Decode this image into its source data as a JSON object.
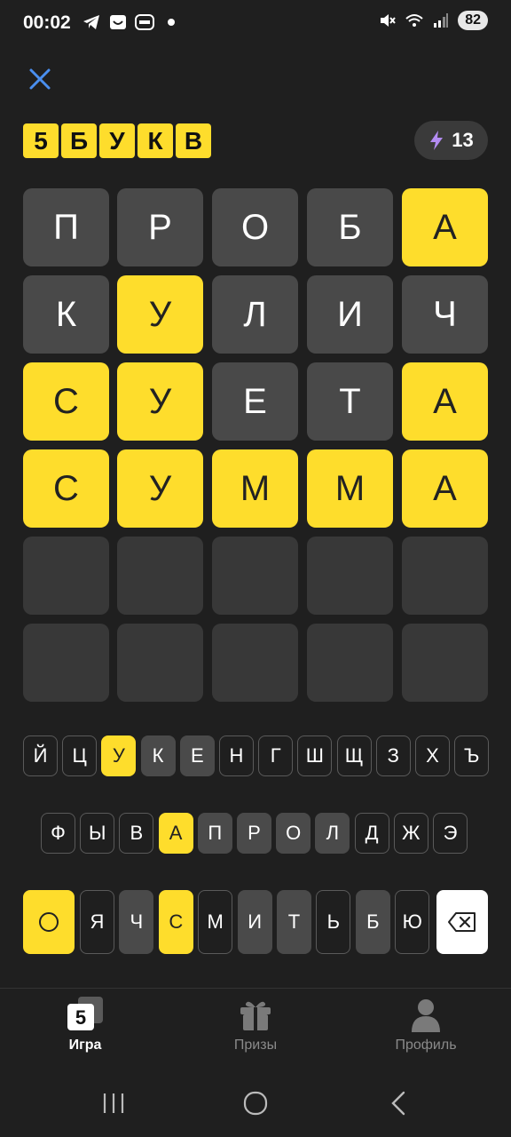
{
  "status": {
    "time": "00:02",
    "battery": "82",
    "icons": [
      "telegram-icon",
      "smile-app-icon",
      "burger-king-icon",
      "dot-icon",
      "mute-icon",
      "wifi-icon",
      "signal-icon"
    ]
  },
  "header": {
    "close_icon": "close-icon",
    "logo_letters": [
      "5",
      "Б",
      "У",
      "К",
      "В"
    ],
    "energy_icon": "lightning-icon",
    "energy_count": "13"
  },
  "board": {
    "rows": [
      [
        {
          "l": "П",
          "s": "gray"
        },
        {
          "l": "Р",
          "s": "gray"
        },
        {
          "l": "О",
          "s": "gray"
        },
        {
          "l": "Б",
          "s": "gray"
        },
        {
          "l": "А",
          "s": "yellow"
        }
      ],
      [
        {
          "l": "К",
          "s": "gray"
        },
        {
          "l": "У",
          "s": "yellow"
        },
        {
          "l": "Л",
          "s": "gray"
        },
        {
          "l": "И",
          "s": "gray"
        },
        {
          "l": "Ч",
          "s": "gray"
        }
      ],
      [
        {
          "l": "С",
          "s": "yellow"
        },
        {
          "l": "У",
          "s": "yellow"
        },
        {
          "l": "Е",
          "s": "gray"
        },
        {
          "l": "Т",
          "s": "gray"
        },
        {
          "l": "А",
          "s": "yellow"
        }
      ],
      [
        {
          "l": "С",
          "s": "yellow"
        },
        {
          "l": "У",
          "s": "yellow"
        },
        {
          "l": "М",
          "s": "yellow"
        },
        {
          "l": "М",
          "s": "yellow"
        },
        {
          "l": "А",
          "s": "yellow"
        }
      ],
      [
        {
          "l": "",
          "s": "empty"
        },
        {
          "l": "",
          "s": "empty"
        },
        {
          "l": "",
          "s": "empty"
        },
        {
          "l": "",
          "s": "empty"
        },
        {
          "l": "",
          "s": "empty"
        }
      ],
      [
        {
          "l": "",
          "s": "empty"
        },
        {
          "l": "",
          "s": "empty"
        },
        {
          "l": "",
          "s": "empty"
        },
        {
          "l": "",
          "s": "empty"
        },
        {
          "l": "",
          "s": "empty"
        }
      ]
    ]
  },
  "keyboard": {
    "row1": [
      {
        "k": "Й",
        "s": "default"
      },
      {
        "k": "Ц",
        "s": "default"
      },
      {
        "k": "У",
        "s": "yellow"
      },
      {
        "k": "К",
        "s": "gray"
      },
      {
        "k": "Е",
        "s": "gray"
      },
      {
        "k": "Н",
        "s": "default"
      },
      {
        "k": "Г",
        "s": "default"
      },
      {
        "k": "Ш",
        "s": "default"
      },
      {
        "k": "Щ",
        "s": "default"
      },
      {
        "k": "З",
        "s": "default"
      },
      {
        "k": "Х",
        "s": "default"
      },
      {
        "k": "Ъ",
        "s": "default"
      }
    ],
    "row2": [
      {
        "k": "Ф",
        "s": "default"
      },
      {
        "k": "Ы",
        "s": "default"
      },
      {
        "k": "В",
        "s": "default"
      },
      {
        "k": "А",
        "s": "yellow"
      },
      {
        "k": "П",
        "s": "gray"
      },
      {
        "k": "Р",
        "s": "gray"
      },
      {
        "k": "О",
        "s": "gray"
      },
      {
        "k": "Л",
        "s": "gray"
      },
      {
        "k": "Д",
        "s": "default"
      },
      {
        "k": "Ж",
        "s": "default"
      },
      {
        "k": "Э",
        "s": "default"
      }
    ],
    "row3": [
      {
        "k": "Я",
        "s": "default"
      },
      {
        "k": "Ч",
        "s": "gray"
      },
      {
        "k": "С",
        "s": "yellow"
      },
      {
        "k": "М",
        "s": "default"
      },
      {
        "k": "И",
        "s": "gray"
      },
      {
        "k": "Т",
        "s": "gray"
      },
      {
        "k": "Ь",
        "s": "default"
      },
      {
        "k": "Б",
        "s": "gray"
      },
      {
        "k": "Ю",
        "s": "default"
      }
    ],
    "enter_icon": "circle-icon",
    "backspace_icon": "backspace-icon"
  },
  "nav": {
    "items": [
      {
        "label": "Игра",
        "icon": "game-5-icon",
        "active": true
      },
      {
        "label": "Призы",
        "icon": "gift-icon",
        "active": false
      },
      {
        "label": "Профиль",
        "icon": "profile-icon",
        "active": false
      }
    ],
    "game_icon_digit": "5"
  },
  "colors": {
    "yellow": "#fedd2c",
    "gray": "#494949",
    "empty": "#383838",
    "background": "#1f1f1f"
  }
}
